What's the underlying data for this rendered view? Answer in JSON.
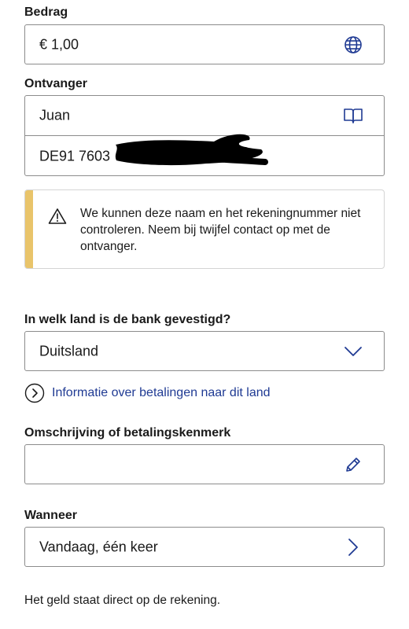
{
  "amount": {
    "label": "Bedrag",
    "value": "€  1,00",
    "icon": "globe-icon"
  },
  "recipient": {
    "label": "Ontvanger",
    "name": "Juan",
    "name_icon": "address-book-icon",
    "iban": "DE91 7603"
  },
  "warning": {
    "text": "We kunnen deze naam en het rekeningnummer niet controleren. Neem bij twijfel contact op met de ontvanger.",
    "icon": "warning-triangle-icon",
    "accent_color": "#e9c46a"
  },
  "bank_country": {
    "label": "In welk land is de bank gevestigd?",
    "value": "Duitsland",
    "icon": "chevron-down-icon"
  },
  "info_link": {
    "text": "Informatie over betalingen naar dit land",
    "icon": "chevron-right-circle-icon",
    "color": "#1f3a93"
  },
  "description": {
    "label": "Omschrijving of betalingskenmerk",
    "value": "",
    "icon": "pencil-icon"
  },
  "when": {
    "label": "Wanneer",
    "value": "Vandaag, één keer",
    "icon": "chevron-right-icon"
  },
  "footer": {
    "note": "Het geld staat direct op de rekening."
  },
  "colors": {
    "accent": "#1f3a93",
    "border": "#8c8c8c"
  }
}
